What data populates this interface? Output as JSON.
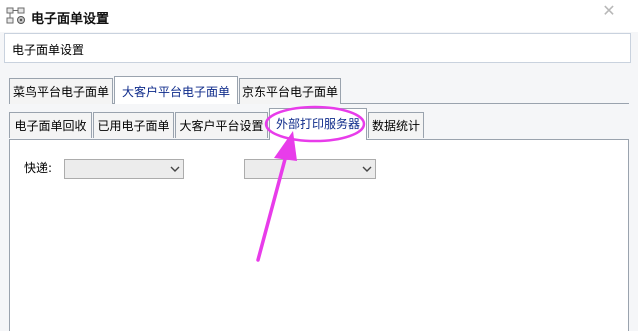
{
  "window": {
    "title": "电子面单设置",
    "close_glyph": "✕"
  },
  "header": {
    "label": "电子面单设置"
  },
  "tabs_row1": [
    {
      "label": "菜鸟平台电子面单"
    },
    {
      "label": "大客户平台电子面单"
    },
    {
      "label": "京东平台电子面单"
    }
  ],
  "tabs_row2": [
    {
      "label": "电子面单回收"
    },
    {
      "label": "已用电子面单"
    },
    {
      "label": "大客户平台设置"
    },
    {
      "label": "外部打印服务器"
    },
    {
      "label": "数据统计"
    }
  ],
  "active_tab_row1": "大客户平台电子面单",
  "active_tab_row2": "外部打印服务器",
  "form": {
    "courier_label": "快递:",
    "courier_select_value": "",
    "second_select_value": ""
  },
  "icons": {
    "app": "settings-tree-icon",
    "close": "close-icon",
    "dropdown": "chevron-down-icon"
  },
  "colors": {
    "annotation": "#e83cea",
    "active_tab_text": "#0d2a8a",
    "border": "#9aa3ae"
  }
}
